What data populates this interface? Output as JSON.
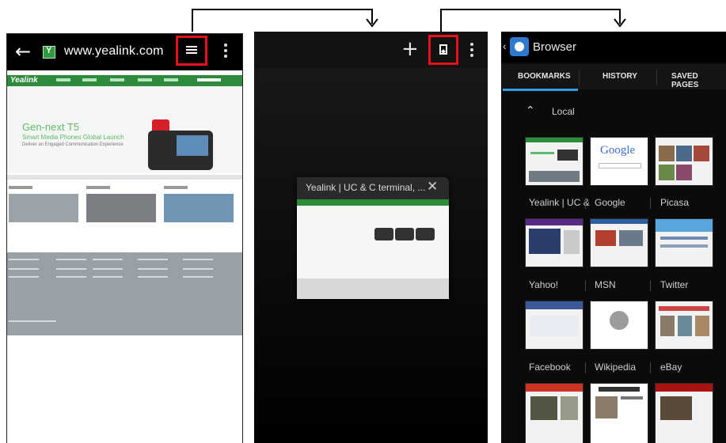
{
  "panel1": {
    "url": "www.yealink.com",
    "page": {
      "logo": "Yealink",
      "hero_title": "Gen-next T5",
      "hero_subtitle": "Smart Media Phones Global Launch",
      "hero_tagline": "Deliver an Engaged Communication Experience"
    }
  },
  "panel2": {
    "tab_title": "Yealink | UC & C terminal, ..."
  },
  "panel3": {
    "title": "Browser",
    "tabs": [
      "BOOKMARKS",
      "HISTORY",
      "SAVED PAGES"
    ],
    "section": "Local",
    "bookmarks": [
      "Yealink | UC &",
      "Google",
      "Picasa",
      "Yahoo!",
      "MSN",
      "Twitter",
      "Facebook",
      "Wikipedia",
      "eBay"
    ],
    "google_logo": "Google"
  },
  "colors": {
    "highlight": "#e8101a",
    "yealink_green": "#2d8c3c",
    "tab_accent": "#2f9ee3"
  }
}
